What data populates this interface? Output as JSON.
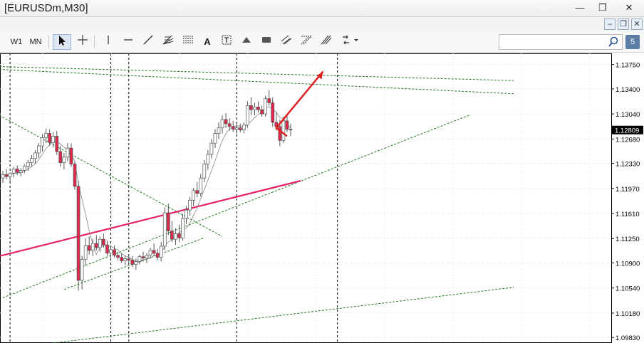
{
  "window": {
    "title": "[EURUSDm,M30]",
    "minimize_glyph": "—",
    "maximize_glyph": "❐",
    "close_glyph": "✕"
  },
  "mdi": {
    "minimize_glyph": "–",
    "restore_glyph": "❐",
    "close_glyph": "✕"
  },
  "toolbar": {
    "timeframes": [
      "W1",
      "MN"
    ],
    "text_tool_label": "A",
    "search_placeholder": "",
    "notification_count": "5"
  },
  "chart_data": {
    "type": "candlestick",
    "symbol": "EURUSDm",
    "timeframe": "M30",
    "y_ticks": [
      "1.13750",
      "1.13400",
      "1.13040",
      "1.12680",
      "1.12330",
      "1.11970",
      "1.11610",
      "1.11250",
      "1.10900",
      "1.10540",
      "1.10180",
      "1.09830"
    ],
    "ylim": [
      1.0975,
      1.1391
    ],
    "current_price": "1.12809",
    "colors": {
      "bull": "#ffffff",
      "bear": "#e0284a",
      "candle_outline": "#555555",
      "ma_fast": "#888888",
      "ma_slow": "#e81f6a",
      "trend": "#227722",
      "arrow": "#e02020",
      "price_label_bg": "#000000"
    },
    "ohlc": [
      [
        1.1212,
        1.1222,
        1.1205,
        1.1217
      ],
      [
        1.1217,
        1.1225,
        1.121,
        1.1214
      ],
      [
        1.1214,
        1.122,
        1.1207,
        1.1219
      ],
      [
        1.1219,
        1.1228,
        1.1213,
        1.1225
      ],
      [
        1.1225,
        1.123,
        1.1216,
        1.122
      ],
      [
        1.122,
        1.1226,
        1.1214,
        1.1223
      ],
      [
        1.1223,
        1.1232,
        1.1219,
        1.1229
      ],
      [
        1.1229,
        1.1238,
        1.1222,
        1.1234
      ],
      [
        1.1234,
        1.1245,
        1.1228,
        1.124
      ],
      [
        1.124,
        1.1252,
        1.1233,
        1.1248
      ],
      [
        1.1248,
        1.1262,
        1.1241,
        1.1258
      ],
      [
        1.1258,
        1.1275,
        1.125,
        1.127
      ],
      [
        1.127,
        1.1283,
        1.1262,
        1.1276
      ],
      [
        1.1276,
        1.1282,
        1.1258,
        1.1263
      ],
      [
        1.1263,
        1.1278,
        1.1256,
        1.1272
      ],
      [
        1.1272,
        1.128,
        1.1245,
        1.125
      ],
      [
        1.125,
        1.1258,
        1.1228,
        1.1234
      ],
      [
        1.1234,
        1.1248,
        1.1224,
        1.1242
      ],
      [
        1.1242,
        1.1262,
        1.1236,
        1.1255
      ],
      [
        1.1255,
        1.1262,
        1.1228,
        1.1232
      ],
      [
        1.1232,
        1.1236,
        1.1195,
        1.12
      ],
      [
        1.12,
        1.1208,
        1.105,
        1.1065
      ],
      [
        1.1065,
        1.11,
        1.1052,
        1.1095
      ],
      [
        1.1095,
        1.1125,
        1.1086,
        1.1115
      ],
      [
        1.1115,
        1.1128,
        1.1102,
        1.1108
      ],
      [
        1.1108,
        1.1124,
        1.11,
        1.1118
      ],
      [
        1.1118,
        1.113,
        1.1108,
        1.1112
      ],
      [
        1.1112,
        1.1128,
        1.1106,
        1.1124
      ],
      [
        1.1124,
        1.1132,
        1.1112,
        1.1116
      ],
      [
        1.1116,
        1.1122,
        1.11,
        1.1104
      ],
      [
        1.1104,
        1.1112,
        1.1096,
        1.1109
      ],
      [
        1.1109,
        1.1115,
        1.1098,
        1.1101
      ],
      [
        1.1101,
        1.1106,
        1.1094,
        1.1098
      ],
      [
        1.1098,
        1.1104,
        1.109,
        1.1093
      ],
      [
        1.1093,
        1.11,
        1.1087,
        1.1096
      ],
      [
        1.1096,
        1.1102,
        1.109,
        1.1094
      ],
      [
        1.1094,
        1.11,
        1.1084,
        1.1088
      ],
      [
        1.1088,
        1.1096,
        1.108,
        1.1092
      ],
      [
        1.1092,
        1.1102,
        1.1088,
        1.1099
      ],
      [
        1.1099,
        1.1106,
        1.1092,
        1.1097
      ],
      [
        1.1097,
        1.1104,
        1.109,
        1.1101
      ],
      [
        1.1101,
        1.1112,
        1.1096,
        1.1108
      ],
      [
        1.1108,
        1.1118,
        1.11,
        1.1104
      ],
      [
        1.1104,
        1.111,
        1.1094,
        1.1098
      ],
      [
        1.1098,
        1.112,
        1.1092,
        1.1114
      ],
      [
        1.1114,
        1.117,
        1.1108,
        1.1162
      ],
      [
        1.1162,
        1.1175,
        1.113,
        1.1136
      ],
      [
        1.1136,
        1.115,
        1.112,
        1.1124
      ],
      [
        1.1124,
        1.114,
        1.1116,
        1.1132
      ],
      [
        1.1132,
        1.1145,
        1.112,
        1.1126
      ],
      [
        1.1126,
        1.116,
        1.1122,
        1.1154
      ],
      [
        1.1154,
        1.1172,
        1.1146,
        1.1166
      ],
      [
        1.1166,
        1.1185,
        1.1158,
        1.118
      ],
      [
        1.118,
        1.1198,
        1.1172,
        1.1194
      ],
      [
        1.1194,
        1.1206,
        1.1184,
        1.119
      ],
      [
        1.119,
        1.1218,
        1.1185,
        1.1212
      ],
      [
        1.1212,
        1.1238,
        1.1206,
        1.1232
      ],
      [
        1.1232,
        1.1252,
        1.1224,
        1.1246
      ],
      [
        1.1246,
        1.1268,
        1.124,
        1.1262
      ],
      [
        1.1262,
        1.1282,
        1.1255,
        1.1276
      ],
      [
        1.1276,
        1.1292,
        1.1268,
        1.1284
      ],
      [
        1.1284,
        1.1302,
        1.1276,
        1.1296
      ],
      [
        1.1296,
        1.1305,
        1.1284,
        1.129
      ],
      [
        1.129,
        1.1298,
        1.128,
        1.1286
      ],
      [
        1.1286,
        1.1294,
        1.1278,
        1.1282
      ],
      [
        1.1282,
        1.129,
        1.1275,
        1.1284
      ],
      [
        1.1284,
        1.129,
        1.1278,
        1.1281
      ],
      [
        1.1281,
        1.1292,
        1.1276,
        1.1288
      ],
      [
        1.1288,
        1.1322,
        1.1284,
        1.1316
      ],
      [
        1.1316,
        1.1328,
        1.1302,
        1.131
      ],
      [
        1.131,
        1.132,
        1.1302,
        1.1314
      ],
      [
        1.1314,
        1.1322,
        1.1306,
        1.131
      ],
      [
        1.131,
        1.1316,
        1.13,
        1.1304
      ],
      [
        1.1304,
        1.133,
        1.13,
        1.1326
      ],
      [
        1.1326,
        1.1338,
        1.1316,
        1.132
      ],
      [
        1.132,
        1.1328,
        1.1286,
        1.1292
      ],
      [
        1.1292,
        1.1306,
        1.128,
        1.1286
      ],
      [
        1.1286,
        1.1296,
        1.1258,
        1.1266
      ],
      [
        1.1266,
        1.13,
        1.1262,
        1.1294
      ],
      [
        1.1294,
        1.1302,
        1.1278,
        1.1282
      ],
      [
        1.1282,
        1.129,
        1.1272,
        1.1281
      ]
    ],
    "ma_slow_endpoints": [
      1.11,
      1.1208
    ],
    "trendlines": [
      {
        "from": [
          -1,
          1.1368
        ],
        "to": [
          142,
          1.1333
        ],
        "style": "dashed"
      },
      {
        "from": [
          -1,
          1.1372
        ],
        "to": [
          142,
          1.1352
        ],
        "style": "dashed"
      },
      {
        "from": [
          -1,
          1.1302
        ],
        "to": [
          61,
          1.1128
        ],
        "style": "dashed"
      },
      {
        "from": [
          17,
          1.1052
        ],
        "to": [
          56,
          1.1126
        ],
        "style": "dashed"
      },
      {
        "from": [
          0,
          1.104
        ],
        "to": [
          130,
          1.1303
        ],
        "style": "dashed"
      },
      {
        "from": [
          14,
          1.0975
        ],
        "to": [
          142,
          1.1055
        ],
        "style": "dashed"
      }
    ],
    "v_lines_bar_index": [
      2,
      30,
      35,
      65,
      93
    ],
    "arrow": {
      "points": [
        [
          79,
          1.1272
        ],
        [
          76,
          1.1284
        ],
        [
          89,
          1.1365
        ]
      ]
    }
  }
}
